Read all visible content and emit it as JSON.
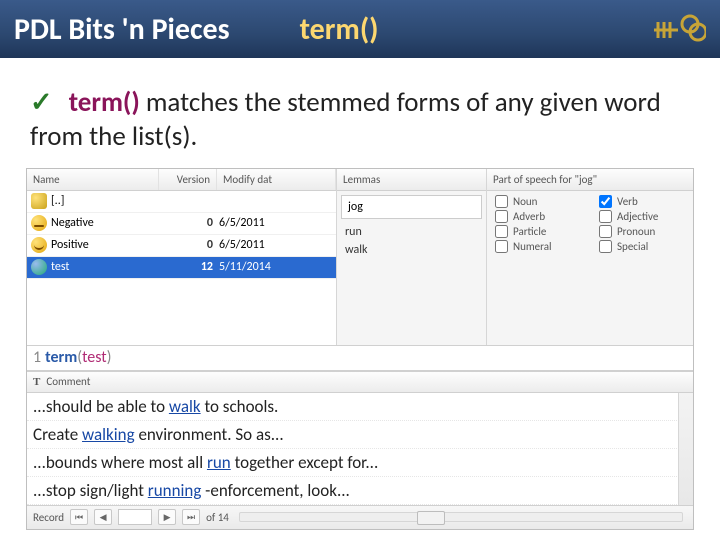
{
  "header": {
    "title": "PDL Bits 'n Pieces",
    "subtitle": "term()"
  },
  "bullet": {
    "prefix": "✓",
    "fn": "term()",
    "text": " matches the stemmed forms of any given word from the list(s)."
  },
  "grid": {
    "headers": {
      "name": "Name",
      "version": "Version",
      "modify": "Modify dat"
    },
    "rows": [
      {
        "icon": "folder",
        "name": "[..]",
        "version": "",
        "modify": ""
      },
      {
        "icon": "neg",
        "name": "Negative",
        "version": "0",
        "modify": "6/5/2011"
      },
      {
        "icon": "pos",
        "name": "Positive",
        "version": "0",
        "modify": "6/5/2011"
      },
      {
        "icon": "test",
        "name": "test",
        "version": "12",
        "modify": "5/11/2014",
        "selected": true
      }
    ]
  },
  "lemmas": {
    "header": "Lemmas",
    "items": [
      "jog",
      "run",
      "walk"
    ]
  },
  "pos": {
    "header": "Part of speech for \"jog\"",
    "opts": [
      {
        "label": "Noun",
        "checked": false
      },
      {
        "label": "Verb",
        "checked": true
      },
      {
        "label": "Adverb",
        "checked": false
      },
      {
        "label": "Adjective",
        "checked": false
      },
      {
        "label": "Particle",
        "checked": false
      },
      {
        "label": "Pronoun",
        "checked": false
      },
      {
        "label": "Numeral",
        "checked": false
      },
      {
        "label": "Special",
        "checked": false
      }
    ]
  },
  "query": {
    "count": "1",
    "keyword": "term",
    "arg": "test"
  },
  "commentHeader": "Comment",
  "results": [
    {
      "pre": "...should be able to ",
      "hl": "walk",
      "post": " to schools."
    },
    {
      "pre": "Create ",
      "hl": "walking",
      "post": " environment. So as..."
    },
    {
      "pre": "...bounds where most all ",
      "hl": "run",
      "post": " together except for..."
    },
    {
      "pre": "...stop sign/light ",
      "hl": "running",
      "post": " -enforcement, look..."
    }
  ],
  "footer": {
    "label": "Record",
    "total": "of 14"
  }
}
